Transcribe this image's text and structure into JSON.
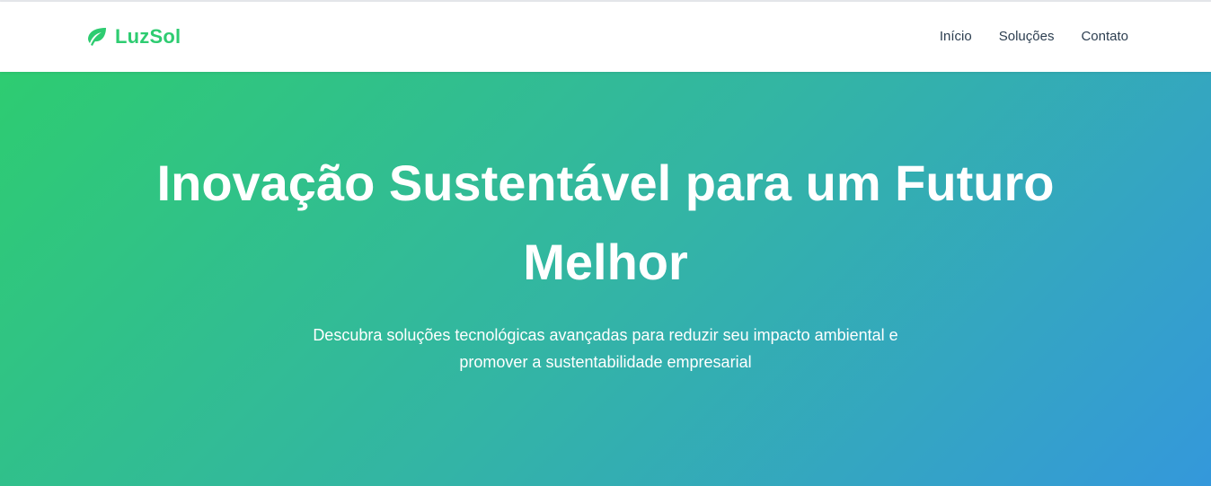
{
  "brand": {
    "name": "LuzSol",
    "icon": "leaf-icon",
    "color": "#2ecc71"
  },
  "nav": {
    "items": [
      {
        "label": "Início"
      },
      {
        "label": "Soluções"
      },
      {
        "label": "Contato"
      }
    ]
  },
  "hero": {
    "title": "Inovação Sustentável para um Futuro Melhor",
    "subtitle": "Descubra soluções tecnológicas avançadas para reduzir seu impacto ambiental e promover a sustentabilidade empresarial",
    "gradient_start": "#2ecc71",
    "gradient_end": "#3498db"
  }
}
